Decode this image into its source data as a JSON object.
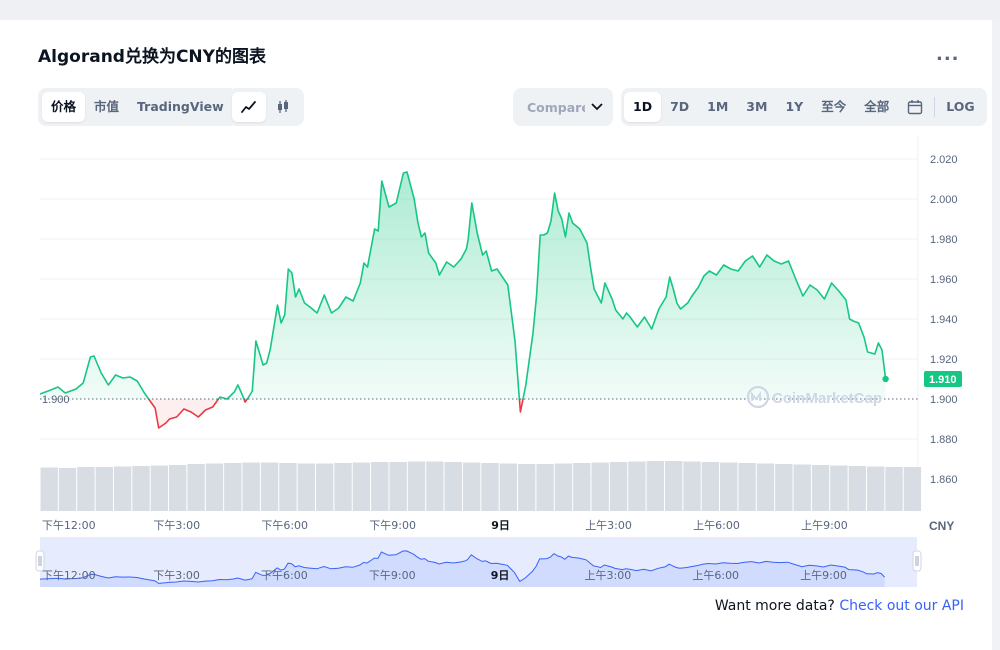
{
  "title": "Algorand兑换为CNY的图表",
  "more_label": "...",
  "view_tabs": [
    "价格",
    "市值",
    "TradingView"
  ],
  "chart_type_icons": [
    "line-chart-icon",
    "candlestick-icon"
  ],
  "compare": {
    "label": "Compare"
  },
  "ranges": [
    "1D",
    "7D",
    "1M",
    "3M",
    "1Y",
    "至今",
    "全部"
  ],
  "log_label": "LOG",
  "calendar_icon": "calendar-icon",
  "footer": {
    "text": "Want more data?",
    "link": "Check out our API"
  },
  "watermark": "CoinMarketCap",
  "colors": {
    "up": "#16c784",
    "down": "#ea3943",
    "accent": "#3861fb",
    "price_tag": "#16c784"
  },
  "chart_data": {
    "type": "area",
    "title": "Algorand兑换为CNY的图表",
    "currency_label": "CNY",
    "baseline": 1.9,
    "baseline_label": "1.900",
    "current_price": 1.91,
    "current_price_label": "1.910",
    "ylim": [
      1.84,
      2.03
    ],
    "y_ticks": [
      2.02,
      2.0,
      1.98,
      1.96,
      1.94,
      1.92,
      1.9,
      1.88,
      1.86
    ],
    "y_tick_labels": [
      "2.020",
      "2.000",
      "1.980",
      "1.960",
      "1.940",
      "1.920",
      "1.900",
      "1.880",
      "1.860"
    ],
    "x_range": [
      0,
      24.4
    ],
    "x_ticks": [
      {
        "x": 0.8,
        "label": "下午12:00",
        "bold": false
      },
      {
        "x": 3.8,
        "label": "下午3:00",
        "bold": false
      },
      {
        "x": 6.8,
        "label": "下午6:00",
        "bold": false
      },
      {
        "x": 9.8,
        "label": "下午9:00",
        "bold": false
      },
      {
        "x": 12.8,
        "label": "9日",
        "bold": true
      },
      {
        "x": 15.8,
        "label": "上午3:00",
        "bold": false
      },
      {
        "x": 18.8,
        "label": "上午6:00",
        "bold": false
      },
      {
        "x": 21.8,
        "label": "上午9:00",
        "bold": false
      }
    ],
    "price_points": [
      [
        0.0,
        1.9025
      ],
      [
        0.3,
        1.9045
      ],
      [
        0.5,
        1.906
      ],
      [
        0.7,
        1.903
      ],
      [
        1.0,
        1.905
      ],
      [
        1.2,
        1.908
      ],
      [
        1.4,
        1.921
      ],
      [
        1.5,
        1.9215
      ],
      [
        1.7,
        1.913
      ],
      [
        1.9,
        1.907
      ],
      [
        2.1,
        1.912
      ],
      [
        2.3,
        1.9105
      ],
      [
        2.5,
        1.911
      ],
      [
        2.7,
        1.909
      ],
      [
        2.9,
        1.903
      ],
      [
        3.1,
        1.898
      ],
      [
        3.2,
        1.8955
      ],
      [
        3.3,
        1.8855
      ],
      [
        3.5,
        1.888
      ],
      [
        3.6,
        1.89
      ],
      [
        3.8,
        1.891
      ],
      [
        4.0,
        1.895
      ],
      [
        4.2,
        1.8935
      ],
      [
        4.4,
        1.891
      ],
      [
        4.6,
        1.8945
      ],
      [
        4.8,
        1.896
      ],
      [
        5.0,
        1.901
      ],
      [
        5.2,
        1.9
      ],
      [
        5.4,
        1.9035
      ],
      [
        5.5,
        1.907
      ],
      [
        5.6,
        1.903
      ],
      [
        5.7,
        1.8985
      ],
      [
        5.8,
        1.901
      ],
      [
        5.9,
        1.904
      ],
      [
        6.0,
        1.929
      ],
      [
        6.1,
        1.923
      ],
      [
        6.2,
        1.917
      ],
      [
        6.3,
        1.918
      ],
      [
        6.4,
        1.925
      ],
      [
        6.6,
        1.947
      ],
      [
        6.7,
        1.938
      ],
      [
        6.8,
        1.942
      ],
      [
        6.9,
        1.965
      ],
      [
        7.0,
        1.963
      ],
      [
        7.1,
        1.951
      ],
      [
        7.2,
        1.955
      ],
      [
        7.35,
        1.948
      ],
      [
        7.5,
        1.946
      ],
      [
        7.7,
        1.943
      ],
      [
        7.9,
        1.952
      ],
      [
        8.1,
        1.943
      ],
      [
        8.3,
        1.9455
      ],
      [
        8.5,
        1.951
      ],
      [
        8.7,
        1.949
      ],
      [
        8.9,
        1.958
      ],
      [
        9.0,
        1.968
      ],
      [
        9.1,
        1.966
      ],
      [
        9.3,
        1.985
      ],
      [
        9.4,
        1.984
      ],
      [
        9.5,
        2.009
      ],
      [
        9.7,
        1.996
      ],
      [
        9.9,
        1.998
      ],
      [
        10.1,
        2.013
      ],
      [
        10.2,
        2.0135
      ],
      [
        10.4,
        2.0
      ],
      [
        10.5,
        1.9885
      ],
      [
        10.6,
        1.981
      ],
      [
        10.7,
        1.983
      ],
      [
        10.8,
        1.973
      ],
      [
        11.0,
        1.968
      ],
      [
        11.1,
        1.962
      ],
      [
        11.3,
        1.9685
      ],
      [
        11.5,
        1.966
      ],
      [
        11.7,
        1.97
      ],
      [
        11.85,
        1.975
      ],
      [
        11.9,
        1.98
      ],
      [
        12.0,
        1.998
      ],
      [
        12.15,
        1.983
      ],
      [
        12.3,
        1.972
      ],
      [
        12.4,
        1.974
      ],
      [
        12.55,
        1.964
      ],
      [
        12.7,
        1.965
      ],
      [
        12.85,
        1.961
      ],
      [
        13.0,
        1.957
      ],
      [
        13.2,
        1.929
      ],
      [
        13.3,
        1.905
      ],
      [
        13.35,
        1.8935
      ],
      [
        13.5,
        1.907
      ],
      [
        13.7,
        1.933
      ],
      [
        13.8,
        1.952
      ],
      [
        13.9,
        1.982
      ],
      [
        14.0,
        1.982
      ],
      [
        14.1,
        1.983
      ],
      [
        14.2,
        1.989
      ],
      [
        14.3,
        2.003
      ],
      [
        14.4,
        1.994
      ],
      [
        14.5,
        1.99
      ],
      [
        14.6,
        1.981
      ],
      [
        14.7,
        1.993
      ],
      [
        14.8,
        1.988
      ],
      [
        15.0,
        1.985
      ],
      [
        15.2,
        1.978
      ],
      [
        15.3,
        1.966
      ],
      [
        15.4,
        1.955
      ],
      [
        15.6,
        1.948
      ],
      [
        15.7,
        1.958
      ],
      [
        15.8,
        1.954
      ],
      [
        15.9,
        1.95
      ],
      [
        16.0,
        1.9445
      ],
      [
        16.2,
        1.94
      ],
      [
        16.3,
        1.943
      ],
      [
        16.4,
        1.941
      ],
      [
        16.6,
        1.936
      ],
      [
        16.8,
        1.941
      ],
      [
        17.0,
        1.935
      ],
      [
        17.2,
        1.945
      ],
      [
        17.4,
        1.951
      ],
      [
        17.5,
        1.961
      ],
      [
        17.6,
        1.955
      ],
      [
        17.7,
        1.948
      ],
      [
        17.8,
        1.945
      ],
      [
        18.0,
        1.948
      ],
      [
        18.1,
        1.951
      ],
      [
        18.3,
        1.956
      ],
      [
        18.45,
        1.9615
      ],
      [
        18.6,
        1.964
      ],
      [
        18.8,
        1.962
      ],
      [
        19.0,
        1.967
      ],
      [
        19.2,
        1.965
      ],
      [
        19.4,
        1.964
      ],
      [
        19.6,
        1.969
      ],
      [
        19.8,
        1.9715
      ],
      [
        20.0,
        1.966
      ],
      [
        20.2,
        1.972
      ],
      [
        20.4,
        1.969
      ],
      [
        20.6,
        1.9675
      ],
      [
        20.8,
        1.969
      ],
      [
        21.0,
        1.96
      ],
      [
        21.2,
        1.9515
      ],
      [
        21.4,
        1.957
      ],
      [
        21.6,
        1.9545
      ],
      [
        21.8,
        1.95
      ],
      [
        22.0,
        1.958
      ],
      [
        22.2,
        1.954
      ],
      [
        22.4,
        1.9495
      ],
      [
        22.5,
        1.94
      ],
      [
        22.6,
        1.939
      ],
      [
        22.75,
        1.938
      ],
      [
        22.9,
        1.931
      ],
      [
        23.0,
        1.9235
      ],
      [
        23.2,
        1.9225
      ],
      [
        23.3,
        1.928
      ],
      [
        23.4,
        1.9245
      ],
      [
        23.5,
        1.91
      ]
    ],
    "volume_range": [
      0,
      24.5
    ],
    "volume_rel": [
      0.87,
      0.86,
      0.88,
      0.88,
      0.89,
      0.9,
      0.91,
      0.92,
      0.94,
      0.95,
      0.96,
      0.97,
      0.97,
      0.96,
      0.95,
      0.95,
      0.96,
      0.97,
      0.98,
      0.98,
      0.99,
      0.99,
      0.98,
      0.97,
      0.96,
      0.95,
      0.94,
      0.94,
      0.95,
      0.96,
      0.97,
      0.98,
      0.99,
      1.0,
      1.0,
      0.99,
      0.98,
      0.97,
      0.96,
      0.95,
      0.94,
      0.93,
      0.92,
      0.91,
      0.9,
      0.89,
      0.88,
      0.88
    ]
  },
  "navigator": {
    "labels": [
      "下午12:00",
      "下午3:00",
      "下午6:00",
      "下午9:00",
      "9日",
      "上午3:00",
      "上午6:00",
      "上午9:00"
    ]
  }
}
